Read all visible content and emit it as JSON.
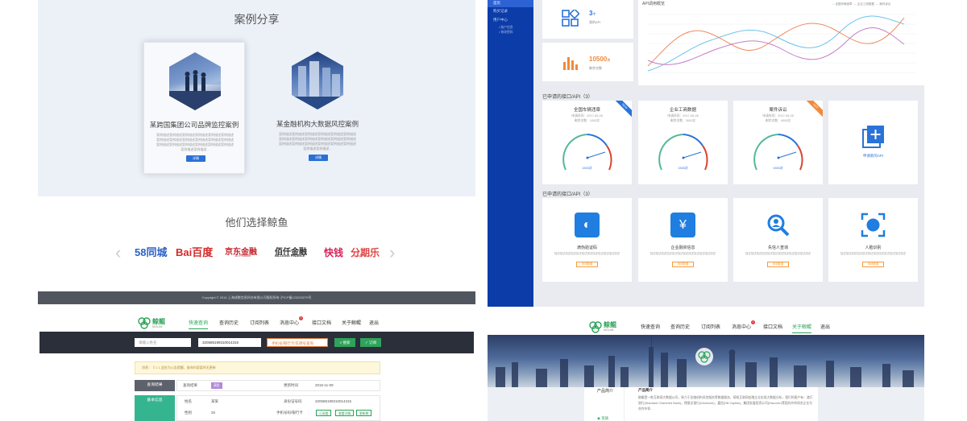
{
  "panel_cases": {
    "section_title": "案例分享",
    "cases": [
      {
        "title": "某跨国集团公司品牌监控案例",
        "desc": "案例描述案例描述案例描述案例描述案例描述案例描述案例描述案例描述案例描述案例描述案例描述案例描述案例描述案例描述案例描述案例描述案例描述案例描述案例描述案例描述...",
        "button": "详情"
      },
      {
        "title": "某金融机构大数据风控案例",
        "desc": "案例描述案例描述案例描述案例描述案例描述案例描述案例描述案例描述案例描述案例描述案例描述案例描述案例描述案例描述案例描述案例描述案例描述案例描述案例描述案例描述...",
        "button": "详情"
      }
    ],
    "clients_title": "他们选择鲸鱼",
    "clients": [
      "58同城",
      "Bai百度",
      "京东金融",
      "佰仟金融",
      "快钱",
      "分期乐"
    ],
    "client_subs": [
      "",
      "",
      "JD Finance",
      "BILLIONS FINANCE",
      "",
      "fenqile.com"
    ],
    "prev_arrow": "‹",
    "next_arrow": "›",
    "footer": "Copyright © 2016 上海成数信息科技有限公司版权所有 沪ICP备123033279号"
  },
  "panel_dashboard": {
    "sidebar": {
      "items": [
        "首页",
        "购买记录",
        "用户中心"
      ],
      "sub_items": [
        "• 账户信息",
        "• 修改密码"
      ]
    },
    "stats": [
      {
        "value": "3",
        "unit": "个",
        "label": "我的API"
      },
      {
        "value": "10500",
        "unit": "次",
        "label": "剩余次数"
      }
    ],
    "chart": {
      "title": "API调用概览",
      "legend": [
        "全国车辆违章",
        "企业工商数据",
        "案件诉讼"
      ]
    },
    "applied_title": "已申请的接口/API（3）",
    "apis": [
      {
        "title": "全国车辆违章",
        "date": "申请时间：2017-05-28",
        "left": "剩余次数：1000次",
        "value": "1500次",
        "ribbon": "NEW"
      },
      {
        "title": "企业工商数据",
        "date": "申请时间：2017-05-28",
        "left": "剩余次数：3000次",
        "value": "1500次",
        "ribbon": ""
      },
      {
        "title": "案件诉讼",
        "date": "申请时间：2017-05-28",
        "left": "剩余次数：4000次",
        "value": "1500次",
        "ribbon": "HOT"
      }
    ],
    "apply_new": "申请新的API",
    "available_title": "已申请的接口/API（3）",
    "services": [
      {
        "title": "滴伪验证码",
        "desc": "描述描述描述描述描述描述描述描述描述描述描述描述",
        "tag": "申请数据",
        "icon": "phone-icon"
      },
      {
        "title": "企业融资信息",
        "desc": "描述描述描述描述描述描述描述描述描述描述描述描述",
        "tag": "申请数据",
        "icon": "yen-doc-icon"
      },
      {
        "title": "失信人查询",
        "desc": "描述描述描述描述描述描述描述描述描述描述描述描述",
        "tag": "申请数据",
        "icon": "person-search-icon"
      },
      {
        "title": "人脸识别",
        "desc": "描述描述描述描述描述描述描述描述描述描述描述描述",
        "tag": "申请数据",
        "icon": "face-scan-icon"
      }
    ]
  },
  "panel_query": {
    "brand": "鲸鲲",
    "brand_sub": "MOLAN",
    "nav": [
      "快速查询",
      "查询历史",
      "订阅列表",
      "消息中心",
      "接口文档",
      "关于鲸鲲",
      "退出"
    ],
    "nav_badge": "1",
    "inputs": [
      "请输入姓名",
      "320585199310014315",
      "手机号/银行卡/车牌号查询"
    ],
    "search_btn": "搜索",
    "subscribe_btn": "订阅",
    "notice": "消息：《 1 1 此处为公告提醒，查询内容暂时无更新",
    "result_label": "查询结果",
    "basic_info": "基本信息",
    "result_row": [
      "查询结果",
      "高危",
      "更新时间",
      "2015-11-09"
    ],
    "rows": [
      [
        "姓名",
        "某某",
        "身份证号码",
        "320585199310014315"
      ],
      [
        "性别",
        "26",
        "手机号码/银行卡",
        ""
      ]
    ],
    "tags": [
      "订阅查",
      "查看详情",
      "更新数"
    ]
  },
  "panel_about": {
    "nav": [
      "快速查询",
      "查询历史",
      "订阅列表",
      "消息中心",
      "接口文档",
      "关于鲸鲲",
      "退出"
    ],
    "nav_badge": "1",
    "product_label": "产品简介",
    "section_heading": "产品简介",
    "text": "鲸鲲是一款互联网大数据公司，致力于金融机构风控服务等数据服务，帮助互联网金融企业实现大数据分析，我们的客户有：渣打银行(Standard Chartered Bank)，德意志银行(Deutsche)，嘉信(DB Capital)，集团发展投资公司(Discover)等国内外的知名企业为合作伙伴...",
    "side_link": "资质"
  }
}
